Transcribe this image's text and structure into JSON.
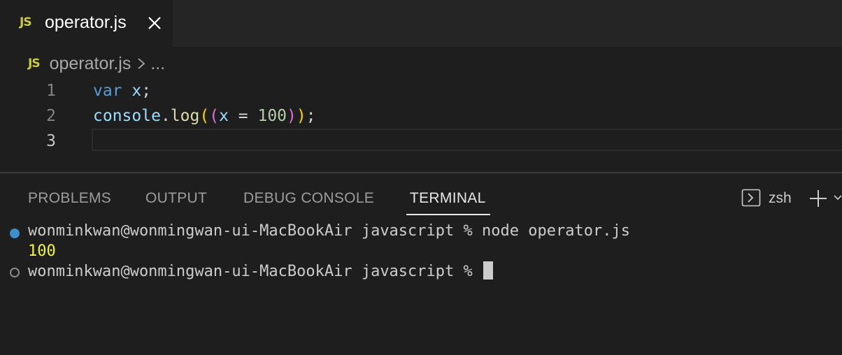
{
  "tab": {
    "badge": "JS",
    "title": "operator.js"
  },
  "breadcrumb": {
    "badge": "JS",
    "file": "operator.js",
    "more": "..."
  },
  "editor": {
    "line_numbers": [
      "1",
      "2",
      "3"
    ],
    "line1": {
      "kw": "var",
      "sp": " ",
      "id": "x",
      "semi": ";"
    },
    "line2": {
      "obj": "console",
      "dot": ".",
      "fn": "log",
      "open1": "(",
      "open2": "(",
      "id": "x",
      "eq": " = ",
      "num": "100",
      "close2": ")",
      "close1": ")",
      "semi": ";"
    }
  },
  "panel": {
    "tabs": [
      "PROBLEMS",
      "OUTPUT",
      "DEBUG CONSOLE",
      "TERMINAL"
    ],
    "active_tab": "TERMINAL",
    "shell": "zsh"
  },
  "terminal": {
    "prompt1": "wonminkwan@wonmingwan-ui-MacBookAir javascript % node operator.js",
    "output": "100",
    "prompt2": "wonminkwan@wonmingwan-ui-MacBookAir javascript % "
  },
  "colors": {
    "accent": "#3d8ec9",
    "js_badge": "#cbcb41",
    "output": "#f5f543"
  }
}
